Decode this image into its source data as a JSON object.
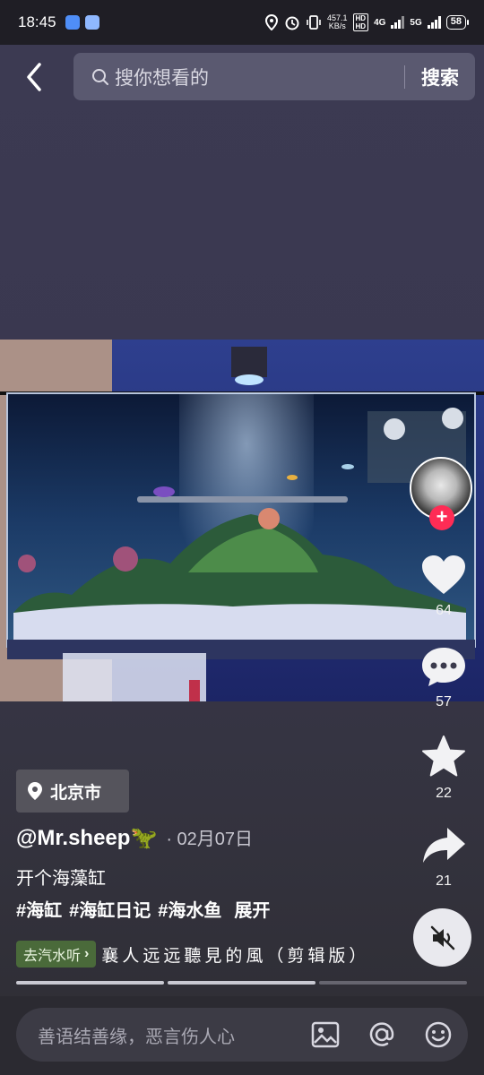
{
  "status_bar": {
    "time": "18:45",
    "net_speed_value": "457.1",
    "net_speed_unit": "KB/s",
    "hd1": "HD",
    "hd2": "HD",
    "net1": "4G",
    "net2": "5G",
    "battery": "58"
  },
  "search": {
    "placeholder": "搜你想看的",
    "submit_label": "搜索"
  },
  "actions": {
    "like_count": "64",
    "comment_count": "57",
    "favorite_count": "22",
    "share_count": "21"
  },
  "post": {
    "location": "北京市",
    "author": "@Mr.sheep🦖",
    "date": "· 02月07日",
    "caption": "开个海藻缸",
    "tags": [
      "#海缸",
      "#海缸日记",
      "#海水鱼"
    ],
    "expand_label": "展开",
    "music_pill": "去汽水听",
    "music_title": "襄人远远聽見的風（剪辑版）"
  },
  "progress_segments": [
    1,
    1,
    0
  ],
  "comment": {
    "placeholder": "善语结善缘，恶言伤人心"
  },
  "colors": {
    "accent_red": "#fe2c55",
    "music_pill": "#4a6a3a"
  }
}
